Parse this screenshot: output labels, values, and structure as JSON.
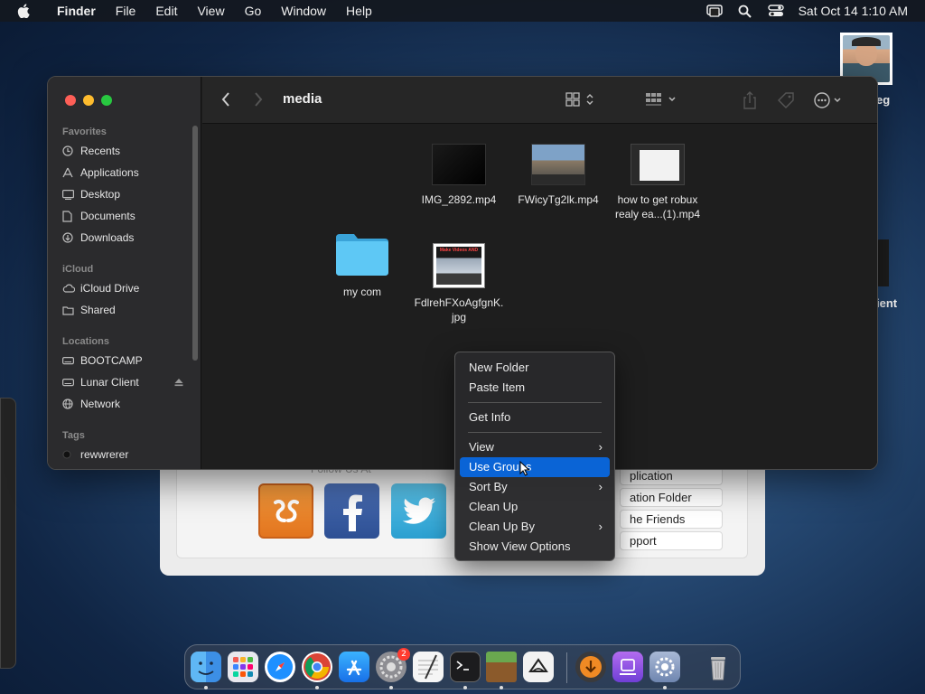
{
  "menubar": {
    "app_name": "Finder",
    "items": [
      "File",
      "Edit",
      "View",
      "Go",
      "Window",
      "Help"
    ],
    "clock": "Sat Oct 14  1:10 AM"
  },
  "desktop": {
    "label_eg": "eg",
    "label_ient": "ient"
  },
  "background_window": {
    "header_fragment": "Follow Us At",
    "buttons": [
      "plication",
      "ation Folder",
      "he Friends",
      "pport"
    ]
  },
  "finder": {
    "title": "media",
    "sidebar": {
      "favorites_header": "Favorites",
      "favorites": [
        "Recents",
        "Applications",
        "Desktop",
        "Documents",
        "Downloads"
      ],
      "icloud_header": "iCloud",
      "icloud": [
        "iCloud Drive",
        "Shared"
      ],
      "locations_header": "Locations",
      "locations": [
        "BOOTCAMP",
        "Lunar Client",
        "Network"
      ],
      "tags_header": "Tags",
      "tags": [
        "rewwrerer"
      ]
    },
    "files": [
      {
        "name": "IMG_2892.mp4"
      },
      {
        "name": "FWicyTg2lk.mp4"
      },
      {
        "name_line1": "how to get robux",
        "name_line2": "realy ea...(1).mp4"
      },
      {
        "name": "my com"
      },
      {
        "name_line1": "FdlrehFXoAgfgnK.",
        "name_line2": "jpg"
      }
    ],
    "thumb_text": "Make Videos AND"
  },
  "context_menu": {
    "group1": [
      "New Folder",
      "Paste Item"
    ],
    "group2": [
      "Get Info"
    ],
    "group3": [
      "View",
      "Use Groups",
      "Sort By",
      "Clean Up",
      "Clean Up By",
      "Show View Options"
    ],
    "submenu_arrow": "›",
    "highlighted": "Use Groups"
  },
  "dock": {
    "badge_count": "2"
  },
  "colors": {
    "accent": "#0a64d6",
    "folder": "#5ec8f5"
  }
}
